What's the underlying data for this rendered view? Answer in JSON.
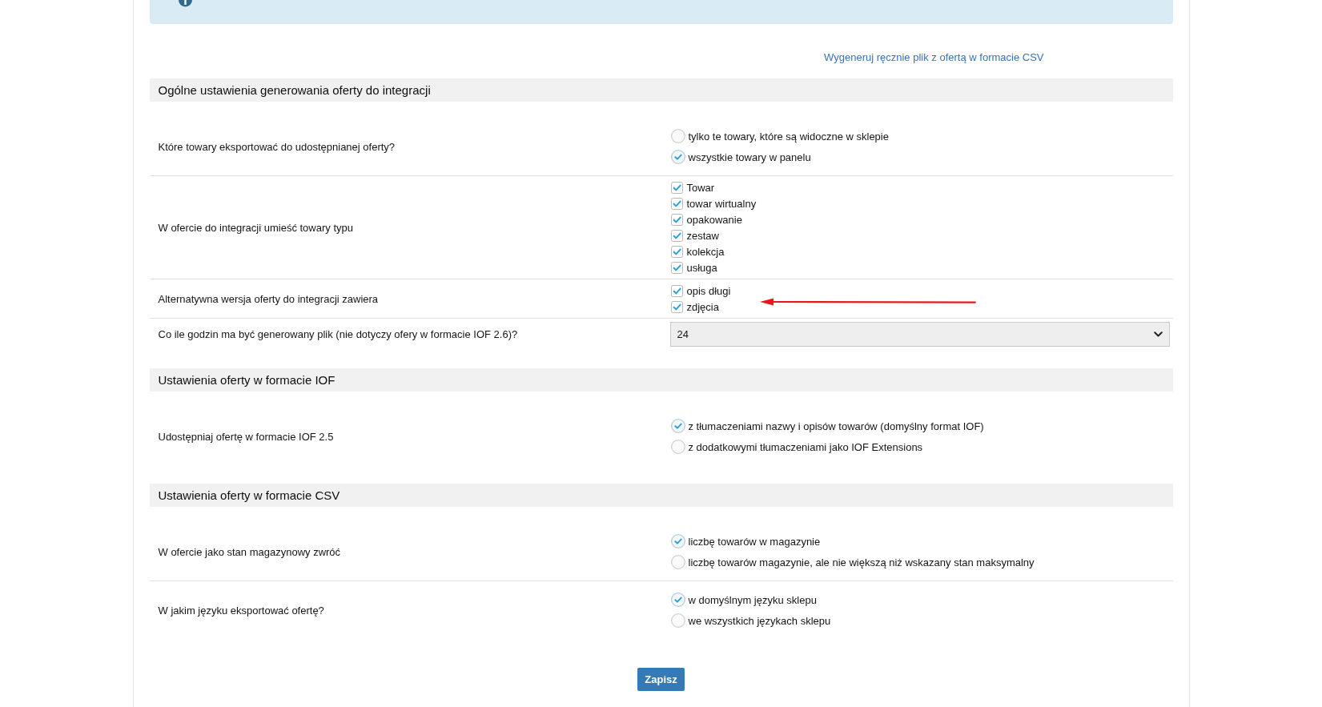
{
  "csv_link": "Wygeneruj ręcznie plik z ofertą w formacie CSV",
  "sections": [
    {
      "title": "Ogólne ustawienia generowania oferty do integracji",
      "rows": [
        {
          "kind": "radio",
          "label": "Które towary eksportować do udostępnianej oferty?",
          "annotated": false,
          "options": [
            {
              "label": "tylko te towary, które są widoczne w sklepie",
              "selected": false
            },
            {
              "label": "wszystkie towary w panelu",
              "selected": true
            }
          ]
        },
        {
          "kind": "checkbox",
          "label": "W ofercie do integracji umieść towary typu",
          "annotated": false,
          "options": [
            {
              "label": "Towar",
              "checked": true
            },
            {
              "label": "towar wirtualny",
              "checked": true
            },
            {
              "label": "opakowanie",
              "checked": true
            },
            {
              "label": "zestaw",
              "checked": true
            },
            {
              "label": "kolekcja",
              "checked": true
            },
            {
              "label": "usługa",
              "checked": true
            }
          ]
        },
        {
          "kind": "checkbox",
          "label": "Alternatywna wersja oferty do integracji zawiera",
          "annotated": true,
          "options": [
            {
              "label": "opis długi",
              "checked": true
            },
            {
              "label": "zdjęcia",
              "checked": true
            }
          ]
        },
        {
          "kind": "select",
          "label": "Co ile godzin ma być generowany plik (nie dotyczy ofery w formacie IOF 2.6)?",
          "annotated": false,
          "value": "24"
        }
      ]
    },
    {
      "title": "Ustawienia oferty w formacie IOF",
      "rows": [
        {
          "kind": "radio",
          "label": "Udostępniaj ofertę w formacie IOF 2.5",
          "annotated": false,
          "options": [
            {
              "label": "z tłumaczeniami nazwy i opisów towarów (domyślny format IOF)",
              "selected": true
            },
            {
              "label": "z dodatkowymi tłumaczeniami jako IOF Extensions",
              "selected": false
            }
          ]
        }
      ]
    },
    {
      "title": "Ustawienia oferty w formacie CSV",
      "rows": [
        {
          "kind": "radio",
          "label": "W ofercie jako stan magazynowy zwróć",
          "annotated": false,
          "options": [
            {
              "label": "liczbę towarów w magazynie",
              "selected": true
            },
            {
              "label": "liczbę towarów magazynie, ale nie większą niż wskazany stan maksymalny",
              "selected": false
            }
          ]
        },
        {
          "kind": "radio",
          "label": "W jakim języku eksportować ofertę?",
          "annotated": false,
          "options": [
            {
              "label": "w domyślnym języku sklepu",
              "selected": true
            },
            {
              "label": "we wszystkich językach sklepu",
              "selected": false
            }
          ]
        }
      ]
    }
  ],
  "save_button": "Zapisz"
}
